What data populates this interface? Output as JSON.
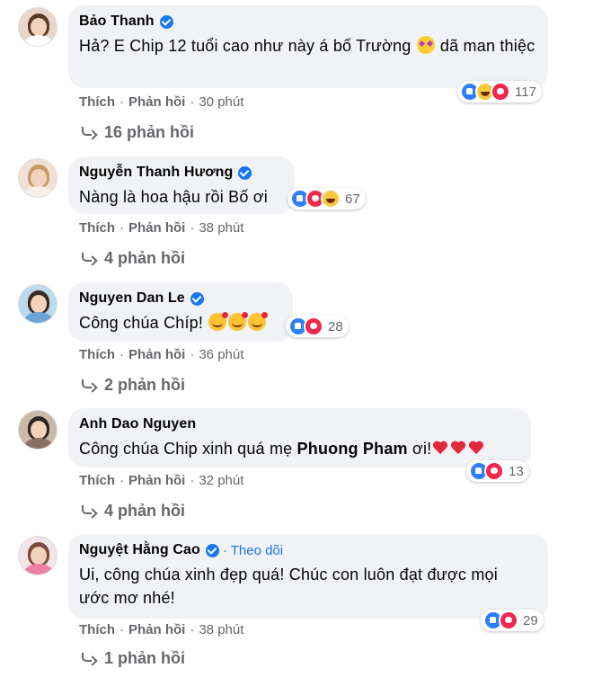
{
  "comments": [
    {
      "name": "Bảo Thanh",
      "verified": true,
      "text_before_emoji": "Hả? E Chip 12 tuổi cao như này á bố Trường ",
      "text_after_emoji": " dã man thiệc",
      "reaction_count": "117",
      "action_like": "Thích",
      "action_reply": "Phản hồi",
      "time": "30 phút",
      "replies": "16 phản hồi"
    },
    {
      "name": "Nguyễn Thanh Hương",
      "verified": true,
      "text": "Nàng là hoa hậu rồi Bố ơi",
      "reaction_count": "67",
      "action_like": "Thích",
      "action_reply": "Phản hồi",
      "time": "38 phút",
      "replies": "4 phản hồi"
    },
    {
      "name": "Nguyen Dan Le",
      "verified": true,
      "text": "Công chúa Chíp!",
      "reaction_count": "28",
      "action_like": "Thích",
      "action_reply": "Phản hồi",
      "time": "36 phút",
      "replies": "2 phản hồi"
    },
    {
      "name": "Anh Dao Nguyen",
      "verified": false,
      "text_before_mention": "Công chúa Chip xinh quá mẹ ",
      "mention": "Phuong Pham",
      "text_after_mention": " ơi!",
      "reaction_count": "13",
      "action_like": "Thích",
      "action_reply": "Phản hồi",
      "time": "32 phút",
      "replies": "4 phản hồi"
    },
    {
      "name": "Nguyệt Hằng Cao",
      "verified": true,
      "follow": "· Theo dõi",
      "text_line1": "Ui, công chúa xinh đẹp quá! Chúc con luôn đạt được mọi",
      "text_line2": "ước mơ nhé!",
      "reaction_count": "29",
      "action_like": "Thích",
      "action_reply": "Phản hồi",
      "time": "38 phút",
      "replies": "1 phản hồi"
    }
  ],
  "icons": {
    "verified": "verified-badge-icon",
    "like": "like-reaction-icon",
    "haha": "haha-reaction-icon",
    "love": "love-reaction-icon",
    "reply": "reply-arrow-icon",
    "star_struck": "star-struck-emoji",
    "smiling_hearts": "smiling-face-with-hearts-emoji",
    "red_heart": "red-heart-emoji"
  },
  "colors": {
    "bubble": "#f0f2f5",
    "link": "#1877f2",
    "secondary_text": "#65676b",
    "like": "#2d7ff9",
    "love": "#f0284a",
    "haha": "#f7c840"
  }
}
